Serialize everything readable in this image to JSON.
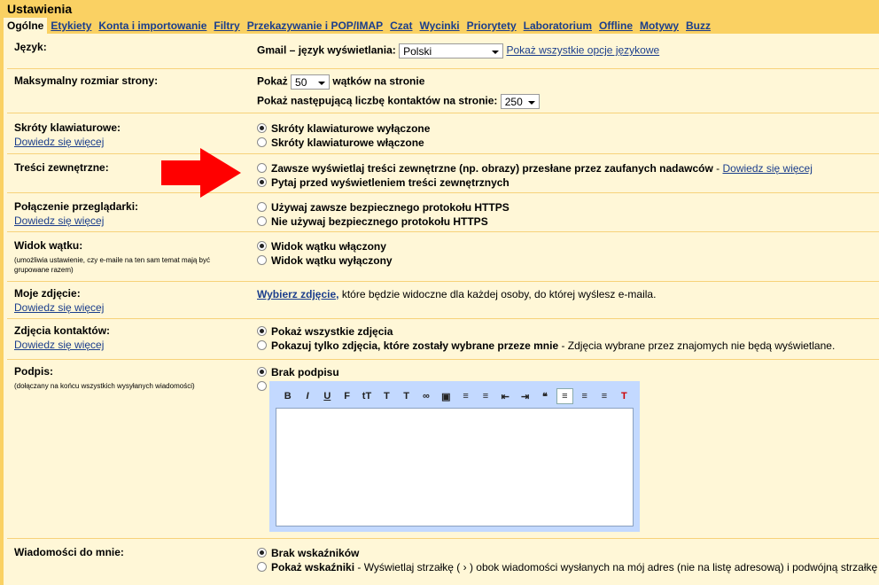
{
  "header": {
    "title": "Ustawienia"
  },
  "tabs": [
    {
      "label": "Ogólne"
    },
    {
      "label": "Etykiety"
    },
    {
      "label": "Konta i importowanie"
    },
    {
      "label": "Filtry"
    },
    {
      "label": "Przekazywanie i POP/IMAP"
    },
    {
      "label": "Czat"
    },
    {
      "label": "Wycinki"
    },
    {
      "label": "Priorytety"
    },
    {
      "label": "Laboratorium"
    },
    {
      "label": "Offline"
    },
    {
      "label": "Motywy"
    },
    {
      "label": "Buzz"
    }
  ],
  "language": {
    "label": "Język:",
    "prefix": "Gmail – język wyświetlania:",
    "value": "Polski",
    "link": "Pokaż wszystkie opcje językowe"
  },
  "page_size": {
    "label": "Maksymalny rozmiar strony:",
    "show": "Pokaż",
    "threads_value": "50",
    "threads_suffix": "wątków na stronie",
    "contacts_prefix": "Pokaż następującą liczbę kontaktów na stronie:",
    "contacts_value": "250"
  },
  "shortcuts": {
    "label": "Skróty klawiaturowe:",
    "learn_more": "Dowiedz się więcej",
    "opt_off": "Skróty klawiaturowe wyłączone",
    "opt_on": "Skróty klawiaturowe włączone"
  },
  "external": {
    "label": "Treści zewnętrzne:",
    "opt_always": "Zawsze wyświetlaj treści zewnętrzne (np. obrazy) przesłane przez zaufanych nadawców",
    "sep": " - ",
    "learn_more": "Dowiedz się więcej",
    "opt_ask": "Pytaj przed wyświetleniem treści zewnętrznych"
  },
  "connection": {
    "label": "Połączenie przeglądarki:",
    "learn_more": "Dowiedz się więcej",
    "opt_https": "Używaj zawsze bezpiecznego protokołu HTTPS",
    "opt_nohttps": "Nie używaj bezpiecznego protokołu HTTPS"
  },
  "thread_view": {
    "label": "Widok wątku:",
    "sub": "(umożliwia ustawienie, czy e-maile na ten sam temat mają być grupowane razem)",
    "opt_on": "Widok wątku włączony",
    "opt_off": "Widok wątku wyłączony"
  },
  "my_picture": {
    "label": "Moje zdjęcie:",
    "learn_more": "Dowiedz się więcej",
    "link": "Wybierz zdjęcie,",
    "text": " które będzie widoczne dla każdej osoby, do której wyślesz e-maila."
  },
  "contact_pictures": {
    "label": "Zdjęcia kontaktów:",
    "learn_more": "Dowiedz się więcej",
    "opt_all": "Pokaż wszystkie zdjęcia",
    "opt_chosen": "Pokazuj tylko zdjęcia, które zostały wybrane przeze mnie",
    "opt_chosen_desc": " - Zdjęcia wybrane przez znajomych nie będą wyświetlane."
  },
  "signature": {
    "label": "Podpis:",
    "sub": "(dołączany na końcu wszystkich wysyłanych wiadomości)",
    "opt_none": "Brak podpisu"
  },
  "editor": {
    "tools": [
      {
        "name": "bold-icon",
        "glyph": "B"
      },
      {
        "name": "italic-icon",
        "glyph": "I"
      },
      {
        "name": "underline-icon",
        "glyph": "U"
      },
      {
        "name": "font-icon",
        "glyph": "F"
      },
      {
        "name": "font-size-icon",
        "glyph": "tT"
      },
      {
        "name": "text-color-icon",
        "glyph": "T"
      },
      {
        "name": "highlight-icon",
        "glyph": "T"
      },
      {
        "name": "link-icon",
        "glyph": "∞"
      },
      {
        "name": "image-icon",
        "glyph": "▣"
      },
      {
        "name": "numbered-list-icon",
        "glyph": "≡"
      },
      {
        "name": "bulleted-list-icon",
        "glyph": "≡"
      },
      {
        "name": "indent-less-icon",
        "glyph": "⇤"
      },
      {
        "name": "indent-more-icon",
        "glyph": "⇥"
      },
      {
        "name": "quote-icon",
        "glyph": "❝"
      },
      {
        "name": "align-left-icon",
        "glyph": "≡"
      },
      {
        "name": "align-center-icon",
        "glyph": "≡"
      },
      {
        "name": "align-right-icon",
        "glyph": "≡"
      },
      {
        "name": "remove-formatting-icon",
        "glyph": "T"
      }
    ]
  },
  "notifications": {
    "label": "Wiadomości do mnie:",
    "opt_none": "Brak wskaźników",
    "opt_show": "Pokaż wskaźniki",
    "opt_show_desc": " - Wyświetlaj strzałkę ( › ) obok wiadomości wysłanych na mój adres (nie na listę adresową) i podwójną strzałkę ( » ) obok wiad"
  },
  "colors": {
    "bar": "#fad163",
    "panel": "#fff7d7",
    "link": "#1b3e8c",
    "arrow": "#ff0000"
  }
}
